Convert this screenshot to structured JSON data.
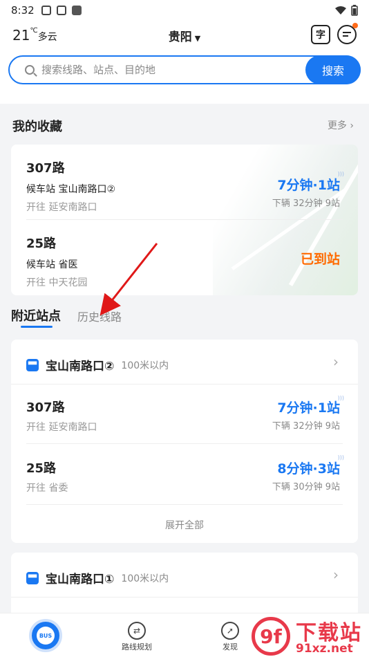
{
  "status_bar": {
    "time": "8:32"
  },
  "header": {
    "temperature": "21",
    "temp_unit": "℃",
    "weather": "多云",
    "city": "贵阳",
    "scan_icon_glyph": "字"
  },
  "search": {
    "placeholder": "搜索线路、站点、目的地",
    "button": "搜索"
  },
  "favorites": {
    "title": "我的收藏",
    "more": "更多",
    "routes": [
      {
        "name": "307路",
        "stop": "候车站 宝山南路口②",
        "direction": "开往 延安南路口",
        "eta": "7分钟·1站",
        "next": "下辆  32分钟 9站"
      },
      {
        "name": "25路",
        "stop": "候车站 省医",
        "direction": "开往 中天花园",
        "eta": "已到站"
      }
    ]
  },
  "tabs": {
    "active": "附近站点",
    "inactive": "历史线路"
  },
  "stations": [
    {
      "name": "宝山南路口②",
      "distance": "100米以内",
      "routes": [
        {
          "name": "307路",
          "direction": "开往 延安南路口",
          "eta": "7分钟·1站",
          "next": "下辆  32分钟 9站"
        },
        {
          "name": "25路",
          "direction": "开往 省委",
          "eta": "8分钟·3站",
          "next": "下辆  30分钟 9站"
        }
      ],
      "expand": "展开全部"
    },
    {
      "name": "宝山南路口①",
      "distance": "100米以内"
    }
  ],
  "bottom_nav": {
    "bus": "BUS",
    "route_plan": "路线规划",
    "discover": "发现"
  },
  "watermark": {
    "logo": "9f",
    "title": "下载站",
    "url": "91xz.net"
  },
  "colors": {
    "accent": "#1a78f2",
    "arrived": "#ff6a00",
    "annotation": "#e01818"
  }
}
